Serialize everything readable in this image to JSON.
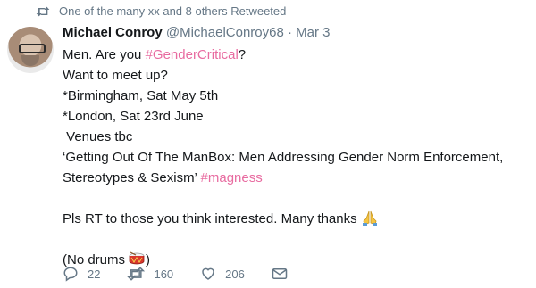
{
  "retweet_header": {
    "text": "One of the many xx and 8 others Retweeted",
    "icon": "retweet-icon"
  },
  "user": {
    "name": "Michael Conroy",
    "handle": "@MichaelConroy68",
    "separator": "·",
    "date": "Mar 3"
  },
  "tweet": {
    "line1_prefix": "Men. Are you ",
    "line1_hashtag": "#GenderCritical",
    "line1_suffix": "?",
    "line2": "Want to meet up?",
    "line3": "*Birmingham, Sat May 5th",
    "line4": "*London, Sat 23rd June",
    "line5": " Venues tbc",
    "line6": "‘Getting Out Of The ManBox: Men Addressing Gender Norm Enforcement,",
    "line7_prefix": "Stereotypes & Sexism’ ",
    "line7_hashtag": "#magness",
    "line8": "Pls RT to those you think interested. Many thanks",
    "line9": "(No drums"
  },
  "actions": {
    "replies": "22",
    "retweets": "160",
    "likes": "206"
  },
  "colors": {
    "hashtag": "#e86ba0",
    "muted": "#657786",
    "text": "#14171a"
  }
}
